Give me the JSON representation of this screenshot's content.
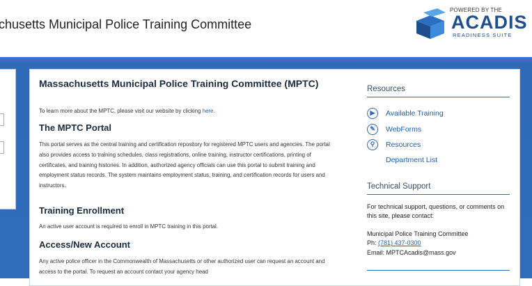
{
  "header": {
    "title": "achusetts Municipal Police Training Committee",
    "logo": {
      "powered_by": "POWERED BY THE",
      "brand": "ACADIS",
      "suite": "READINESS SUITE"
    }
  },
  "main": {
    "title": "Massachusetts Municipal Police Training Committee (MPTC)",
    "intro_prefix": "To learn more about the MPTC, please visit our website by clicking ",
    "intro_link": "here",
    "intro_suffix": ".",
    "sections": [
      {
        "heading": "The MPTC Portal",
        "body": "This portal serves as the central training and certification repository for registered MPTC users and agencies. The portal also provides access to training schedules, class registrations, online training, instructor certifications, printing of certificates, and training histories. In addition, authorized agency officials can use this portal to submit training and employment status records. The system maintains employment status, training, and certification records for users and instructors."
      },
      {
        "heading": "Training Enrollment",
        "body": "An active user account is required to enroll in MPTC training in this portal."
      },
      {
        "heading": "Access/New Account",
        "body": "Any active police officer in the Commonwealth of Massachusetts or other authorized user can request an account and access to the portal. To request an account contact your agency head"
      }
    ]
  },
  "sidebar": {
    "resources_heading": "Resources",
    "resources": [
      {
        "label": "Available Training",
        "icon": "training-icon"
      },
      {
        "label": "WebForms",
        "icon": "webforms-icon"
      },
      {
        "label": "Resources",
        "icon": "search-icon"
      },
      {
        "label": "Department List",
        "icon": ""
      }
    ],
    "support_heading": "Technical Support",
    "support_text": "For technical support, questions, or comments on this site, please contact:",
    "org_name": "Municipal Police Training Committee",
    "phone_label": "Ph: ",
    "phone": "(781) 437-0300",
    "email_label": "Email: ",
    "email": "MPTCAcadis@mass.gov"
  },
  "colors": {
    "band": "#2f6cb9",
    "link": "#1f5fb0",
    "brand": "#1d4f8f"
  }
}
